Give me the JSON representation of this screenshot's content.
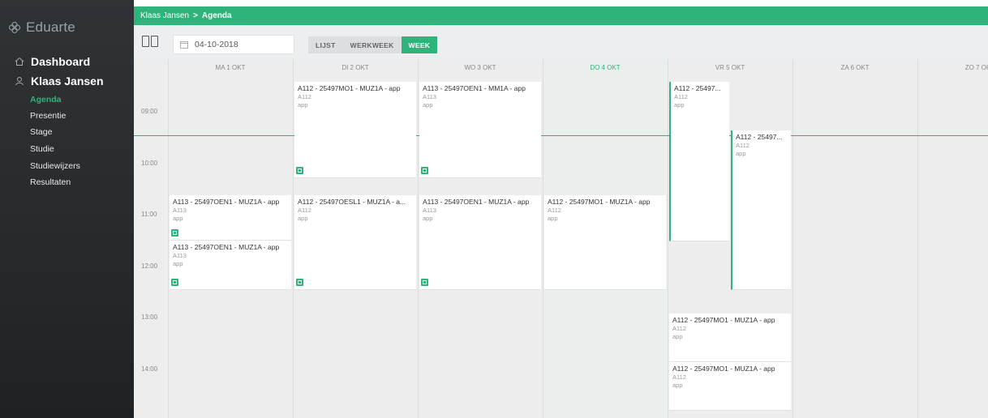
{
  "app": {
    "logo_text": "Eduarte",
    "colors": {
      "accent": "#2eb37a",
      "sidebar": "#2b2f31",
      "calendar_bg": "#ededed"
    }
  },
  "sidebar": {
    "main_items": [
      {
        "label": "Dashboard",
        "icon": "home-icon"
      },
      {
        "label": "Klaas Jansen",
        "icon": "user-icon"
      }
    ],
    "sub_items": [
      {
        "label": "Agenda",
        "active": true
      },
      {
        "label": "Presentie"
      },
      {
        "label": "Stage"
      },
      {
        "label": "Studie"
      },
      {
        "label": "Studiewijzers"
      },
      {
        "label": "Resultaten"
      }
    ]
  },
  "breadcrumb": {
    "parent": "Klaas Jansen",
    "separator": ">",
    "current": "Agenda"
  },
  "toolbar": {
    "date_value": "04-10-2018",
    "view_tabs": [
      {
        "label": "LIJST"
      },
      {
        "label": "WERKWEEK"
      },
      {
        "label": "WEEK",
        "active": true
      }
    ]
  },
  "calendar": {
    "days": [
      {
        "label": "MA 1 OKT"
      },
      {
        "label": "DI 2 OKT"
      },
      {
        "label": "WO 3 OKT"
      },
      {
        "label": "DO 4 OKT",
        "today": true
      },
      {
        "label": "VR 5 OKT"
      },
      {
        "label": "ZA 6 OKT"
      },
      {
        "label": "ZO 7 OKT"
      }
    ],
    "times": [
      "09:00",
      "10:00",
      "11:00",
      "12:00",
      "13:00",
      "14:00"
    ],
    "events": [
      {
        "day": 1,
        "title": "A112 - 25497MO1 - MUZ1A - app",
        "room": "A112",
        "type": "app",
        "start": "08:45",
        "end": "10:45",
        "flag": true
      },
      {
        "day": 2,
        "title": "A113 - 25497OEN1 - MM1A - app",
        "room": "A113",
        "type": "app",
        "start": "08:45",
        "end": "10:45",
        "flag": true
      },
      {
        "day": 4,
        "title": "A112 - 25497...",
        "room": "A112",
        "type": "app",
        "start": "08:45",
        "end": "11:30",
        "half": "left"
      },
      {
        "day": 4,
        "title": "A112 - 25497...",
        "room": "A112",
        "type": "app",
        "start": "09:30",
        "end": "12:00",
        "half": "right"
      },
      {
        "day": 0,
        "title": "A113 - 25497OEN1 - MUZ1A - app",
        "room": "A113",
        "type": "app",
        "start": "11:00",
        "end": "11:30",
        "flag": true
      },
      {
        "day": 0,
        "title": "A113 - 25497OEN1 - MUZ1A - app",
        "room": "A113",
        "type": "app",
        "start": "11:30",
        "end": "12:00",
        "flag": true
      },
      {
        "day": 1,
        "title": "A112 - 25497OESL1 - MUZ1A - a...",
        "room": "A112",
        "type": "app",
        "start": "11:00",
        "end": "12:00",
        "flag": true
      },
      {
        "day": 2,
        "title": "A113 - 25497OEN1 - MUZ1A - app",
        "room": "A113",
        "type": "app",
        "start": "11:00",
        "end": "12:00",
        "flag": true
      },
      {
        "day": 3,
        "title": "A112 - 25497MO1 - MUZ1A - app",
        "room": "A112",
        "type": "app",
        "start": "11:00",
        "end": "12:00"
      },
      {
        "day": 4,
        "title": "A112 - 25497MO1 - MUZ1A - app",
        "room": "A112",
        "type": "app",
        "start": "12:30",
        "end": "13:00"
      },
      {
        "day": 4,
        "title": "A112 - 25497MO1 - MUZ1A - app",
        "room": "A112",
        "type": "app",
        "start": "13:00",
        "end": "13:30"
      }
    ]
  }
}
